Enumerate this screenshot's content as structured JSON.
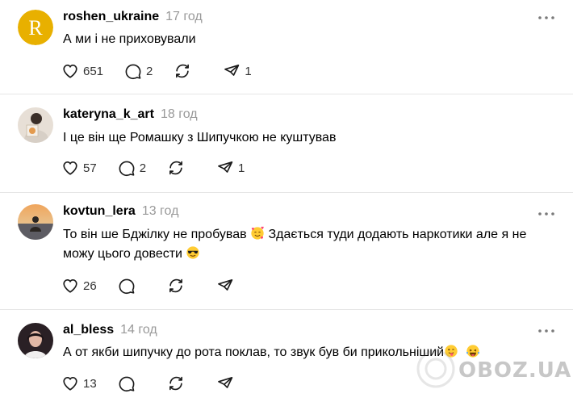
{
  "posts": [
    {
      "username": "roshen_ukraine",
      "time": "17 год",
      "text": "А ми і не приховували",
      "avatar_icon": "roshen-logo-icon",
      "avatar_letter": "R",
      "likes": "651",
      "replies": "2",
      "reposts": "",
      "shares": "1"
    },
    {
      "username": "kateryna_k_art",
      "time": "18 год",
      "text": "І це він ще Ромашку з Шипучкою не куштував",
      "avatar_icon": "user-photo-icon",
      "likes": "57",
      "replies": "2",
      "reposts": "",
      "shares": "1"
    },
    {
      "username": "kovtun_lera",
      "time": "13 год",
      "text_part1": "То він ше Бджілку не пробував",
      "text_part2": "Здається туди додають наркотики але я не можу цього довести",
      "emoji1": "smiling-face-with-hearts-emoji",
      "emoji2": "sunglasses-face-emoji",
      "avatar_icon": "user-photo-icon",
      "likes": "26",
      "replies": "",
      "reposts": "",
      "shares": ""
    },
    {
      "username": "al_bless",
      "time": "14 год",
      "text": "А от якби шипучку до рота поклав, то звук був би прикольніший",
      "emoji1": "winking-face-with-tongue-emoji",
      "emoji2": "laughing-face-emoji",
      "avatar_icon": "user-photo-icon",
      "likes": "13",
      "replies": "",
      "reposts": "",
      "shares": ""
    }
  ],
  "icons": {
    "like": "heart-icon",
    "reply": "comment-icon",
    "repost": "repost-icon",
    "share": "send-icon",
    "more": "more-options-icon"
  },
  "colors": {
    "roshen_brand": "#e8b000",
    "username": "#000000",
    "timestamp": "#999999",
    "divider": "#e6e6e6"
  },
  "watermark": {
    "text": "OBOZ.UA"
  }
}
